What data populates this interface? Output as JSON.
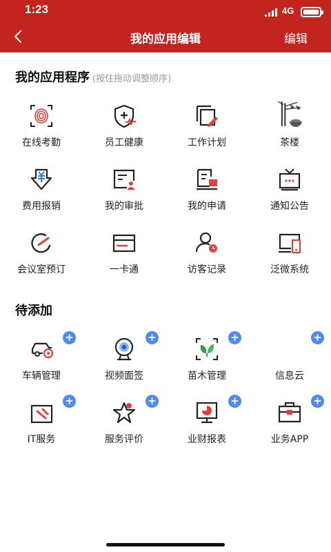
{
  "status_bar": {
    "time": "1:23",
    "network": "4G"
  },
  "header": {
    "title": "我的应用编辑",
    "edit_label": "编辑"
  },
  "my_apps": {
    "title": "我的应用程序",
    "hint": "(按住拖动调整顺序)",
    "items": [
      {
        "label": "在线考勤",
        "icon": "fingerprint-icon"
      },
      {
        "label": "员工健康",
        "icon": "health-shield-icon"
      },
      {
        "label": "工作计划",
        "icon": "plan-edit-icon"
      },
      {
        "label": "茶楼",
        "icon": "tea-house-icon"
      },
      {
        "label": "费用报销",
        "icon": "expense-yen-icon"
      },
      {
        "label": "我的审批",
        "icon": "approval-icon"
      },
      {
        "label": "我的申请",
        "icon": "application-icon"
      },
      {
        "label": "通知公告",
        "icon": "tv-notice-icon"
      },
      {
        "label": "会议室预订",
        "icon": "meeting-gauge-icon"
      },
      {
        "label": "一卡通",
        "icon": "card-icon"
      },
      {
        "label": "访客记录",
        "icon": "visitor-icon"
      },
      {
        "label": "泛微系统",
        "icon": "system-monitor-icon"
      }
    ]
  },
  "pending": {
    "title": "待添加",
    "items": [
      {
        "label": "车辆管理",
        "icon": "vehicle-icon"
      },
      {
        "label": "视频面签",
        "icon": "webcam-icon"
      },
      {
        "label": "苗木管理",
        "icon": "seedling-icon"
      },
      {
        "label": "信息云",
        "icon": "info-cloud-icon"
      },
      {
        "label": "IT服务",
        "icon": "it-service-icon"
      },
      {
        "label": "服务评价",
        "icon": "star-rating-icon"
      },
      {
        "label": "业财报表",
        "icon": "finance-report-icon"
      },
      {
        "label": "业务APP",
        "icon": "briefcase-icon"
      }
    ],
    "add_symbol": "+"
  },
  "colors": {
    "header": "#c4241e",
    "accent_red": "#e0403a",
    "add_badge": "#4e8af1",
    "hint": "#9a9a9a"
  }
}
